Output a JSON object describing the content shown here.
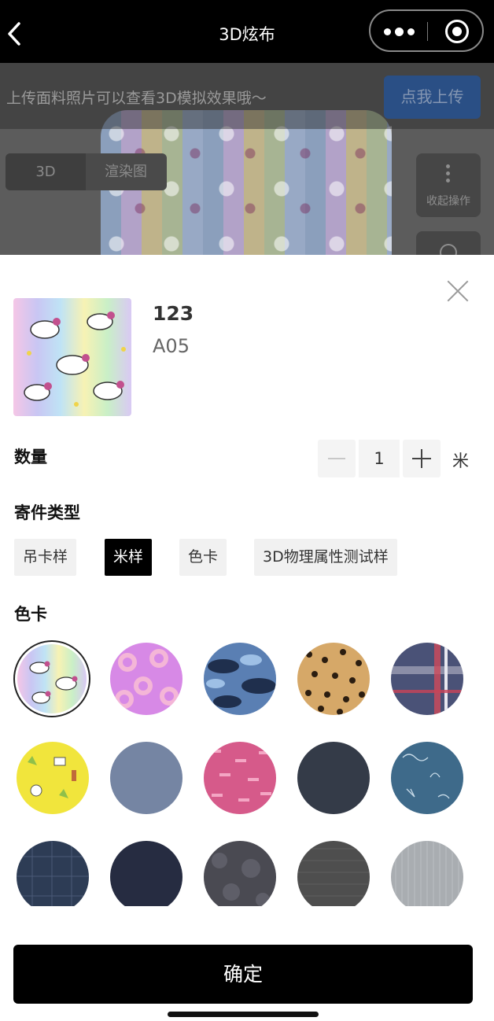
{
  "navbar": {
    "title": "3D炫布",
    "back_icon": "chevron-left-icon",
    "menu_icon": "more-dots-icon",
    "capsule_icon": "target-circle-icon"
  },
  "background": {
    "banner_text": "上传面料照片可以查看3D模拟效果哦～",
    "upload_button": "点我上传",
    "tabs": [
      "3D",
      "渲染图"
    ],
    "collapse_label": "收起操作"
  },
  "product": {
    "name": "123",
    "code": "A05"
  },
  "quantity": {
    "label": "数量",
    "value": "1",
    "unit": "米"
  },
  "shipping": {
    "label": "寄件类型",
    "options": [
      "吊卡样",
      "米样",
      "色卡",
      "3D物理属性测试样"
    ],
    "selected": "米样"
  },
  "colorcards": {
    "label": "色卡",
    "swatches": [
      {
        "name": "unicorn-rainbow",
        "color": "#c9d7f2"
      },
      {
        "name": "donut-purple",
        "color": "#d789e6"
      },
      {
        "name": "blue-camouflage",
        "color": "#4f6f9f"
      },
      {
        "name": "leopard",
        "color": "#c99a5b"
      },
      {
        "name": "navy-plaid",
        "color": "#4a5277"
      },
      {
        "name": "yellow-doodle",
        "color": "#f1e53c"
      },
      {
        "name": "slate-blue",
        "color": "#7585a3"
      },
      {
        "name": "pink-pattern",
        "color": "#d65a8a"
      },
      {
        "name": "charcoal",
        "color": "#343b48"
      },
      {
        "name": "teal-sketch",
        "color": "#3e6a8a"
      },
      {
        "name": "dark-check",
        "color": "#2d3c55"
      },
      {
        "name": "midnight-navy",
        "color": "#262c41"
      },
      {
        "name": "dark-floral",
        "color": "#4a4a52"
      },
      {
        "name": "gray-tweed",
        "color": "#4e4e4e"
      },
      {
        "name": "silver-stripe",
        "color": "#a9adb1"
      }
    ]
  },
  "confirm_button": "确定",
  "colors": {
    "primary": "#000000",
    "banner_button": "#2a4f85",
    "chip_bg": "#f1f1f1"
  }
}
